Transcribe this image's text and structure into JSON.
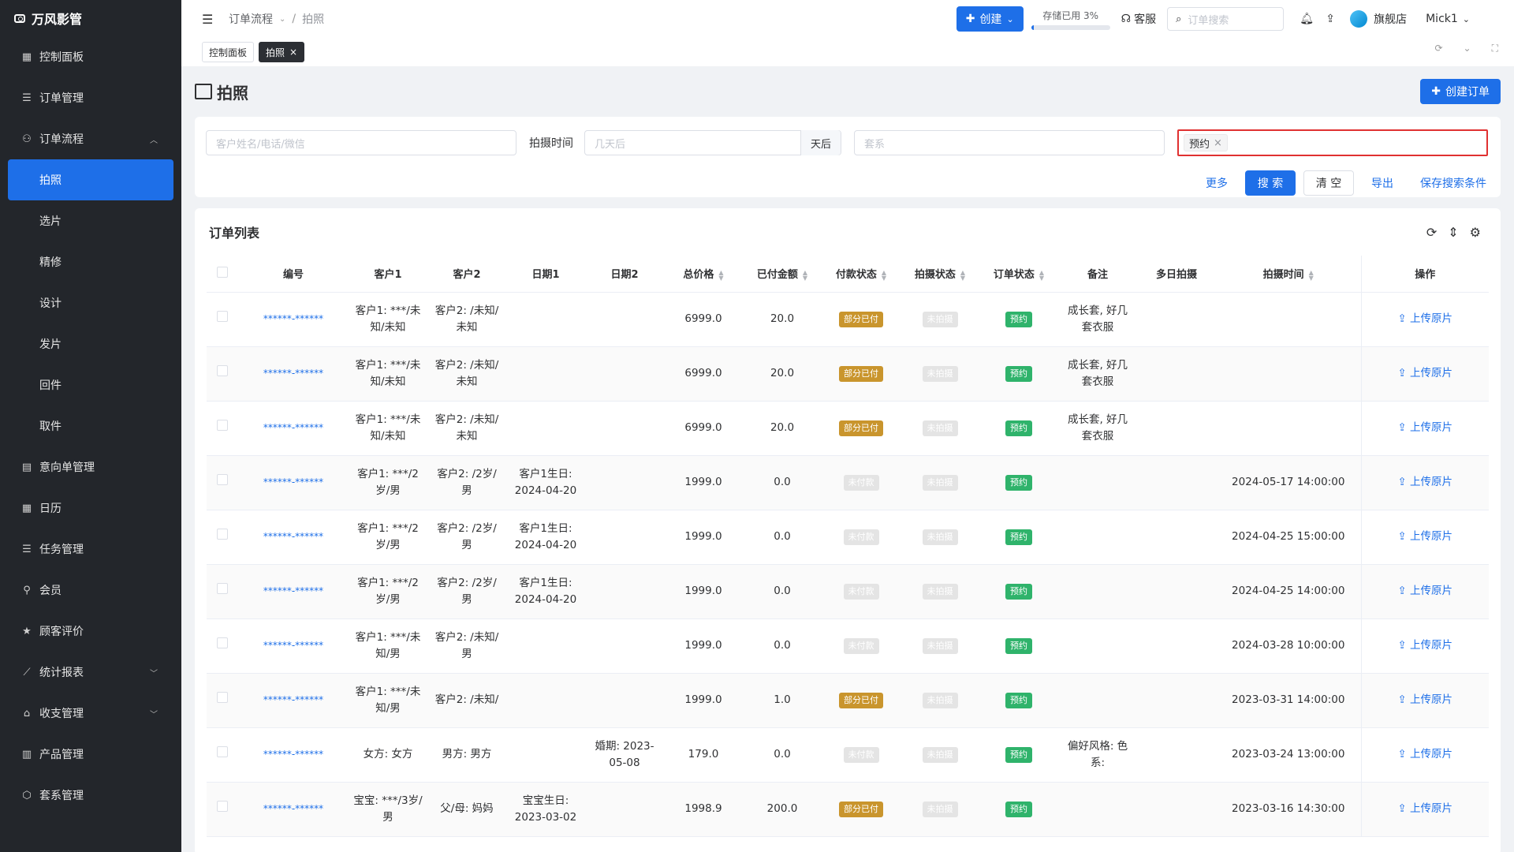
{
  "brand": "万风影管",
  "sidebar": {
    "items": [
      {
        "label": "控制面板",
        "icon": "dashboard-icon"
      },
      {
        "label": "订单管理",
        "icon": "list-icon"
      },
      {
        "label": "订单流程",
        "icon": "flow-icon",
        "expanded": true
      },
      {
        "label": "意向单管理",
        "icon": "clipboard-icon"
      },
      {
        "label": "日历",
        "icon": "calendar-icon"
      },
      {
        "label": "任务管理",
        "icon": "task-icon"
      },
      {
        "label": "会员",
        "icon": "user-icon"
      },
      {
        "label": "顾客评价",
        "icon": "star-icon"
      },
      {
        "label": "统计报表",
        "icon": "chart-icon"
      },
      {
        "label": "收支管理",
        "icon": "bank-icon"
      },
      {
        "label": "产品管理",
        "icon": "product-icon"
      },
      {
        "label": "套系管理",
        "icon": "package-icon"
      }
    ],
    "sub_items": [
      "拍照",
      "选片",
      "精修",
      "设计",
      "发片",
      "回件",
      "取件"
    ],
    "active_sub": "拍照"
  },
  "header": {
    "breadcrumb": [
      "订单流程",
      "拍照"
    ],
    "create_label": "创建",
    "storage_label": "存储已用 3%",
    "storage_used": 0.03,
    "service_label": "客服",
    "search_placeholder": "订单搜索",
    "shop_label": "旗舰店",
    "user_label": "Mick1"
  },
  "tabs": [
    {
      "label": "控制面板",
      "active": false
    },
    {
      "label": "拍照",
      "active": true
    }
  ],
  "page": {
    "title": "拍照",
    "create_order_label": "创建订单"
  },
  "filters": {
    "customer_placeholder": "客户姓名/电话/微信",
    "time_label": "拍摄时间",
    "days_placeholder": "几天后",
    "days_suffix": "天后",
    "package_placeholder": "套系",
    "chip_label": "预约",
    "more_label": "更多",
    "search_label": "搜 索",
    "clear_label": "清 空",
    "export_label": "导出",
    "save_label": "保存搜索条件"
  },
  "table": {
    "title": "订单列表",
    "columns": [
      "编号",
      "客户1",
      "客户2",
      "日期1",
      "日期2",
      "总价格",
      "已付金额",
      "付款状态",
      "拍摄状态",
      "订单状态",
      "备注",
      "多日拍摄",
      "拍摄时间",
      "操作"
    ],
    "action_label": "上传原片",
    "rows": [
      {
        "id": "******-******",
        "c1": "客户1: ***/未知/未知",
        "c2": "客户2: /未知/未知",
        "d1": "",
        "d2": "",
        "total": "6999.0",
        "paid": "20.0",
        "pay": "部分已付",
        "shoot": "未拍摄",
        "order": "预约",
        "note": "成长套, 好几套衣服",
        "multi": "",
        "time": ""
      },
      {
        "id": "******-******",
        "c1": "客户1: ***/未知/未知",
        "c2": "客户2: /未知/未知",
        "d1": "",
        "d2": "",
        "total": "6999.0",
        "paid": "20.0",
        "pay": "部分已付",
        "shoot": "未拍摄",
        "order": "预约",
        "note": "成长套, 好几套衣服",
        "multi": "",
        "time": ""
      },
      {
        "id": "******-******",
        "c1": "客户1: ***/未知/未知",
        "c2": "客户2: /未知/未知",
        "d1": "",
        "d2": "",
        "total": "6999.0",
        "paid": "20.0",
        "pay": "部分已付",
        "shoot": "未拍摄",
        "order": "预约",
        "note": "成长套, 好几套衣服",
        "multi": "",
        "time": ""
      },
      {
        "id": "******-******",
        "c1": "客户1: ***/2岁/男",
        "c2": "客户2: /2岁/男",
        "d1": "客户1生日: 2024-04-20",
        "d2": "",
        "total": "1999.0",
        "paid": "0.0",
        "pay": "未付款",
        "shoot": "未拍摄",
        "order": "预约",
        "note": "",
        "multi": "",
        "time": "2024-05-17 14:00:00"
      },
      {
        "id": "******-******",
        "c1": "客户1: ***/2岁/男",
        "c2": "客户2: /2岁/男",
        "d1": "客户1生日: 2024-04-20",
        "d2": "",
        "total": "1999.0",
        "paid": "0.0",
        "pay": "未付款",
        "shoot": "未拍摄",
        "order": "预约",
        "note": "",
        "multi": "",
        "time": "2024-04-25 15:00:00"
      },
      {
        "id": "******-******",
        "c1": "客户1: ***/2岁/男",
        "c2": "客户2: /2岁/男",
        "d1": "客户1生日: 2024-04-20",
        "d2": "",
        "total": "1999.0",
        "paid": "0.0",
        "pay": "未付款",
        "shoot": "未拍摄",
        "order": "预约",
        "note": "",
        "multi": "",
        "time": "2024-04-25 14:00:00"
      },
      {
        "id": "******-******",
        "c1": "客户1: ***/未知/男",
        "c2": "客户2: /未知/男",
        "d1": "",
        "d2": "",
        "total": "1999.0",
        "paid": "0.0",
        "pay": "未付款",
        "shoot": "未拍摄",
        "order": "预约",
        "note": "",
        "multi": "",
        "time": "2024-03-28 10:00:00"
      },
      {
        "id": "******-******",
        "c1": "客户1: ***/未知/男",
        "c2": "客户2: /未知/",
        "d1": "",
        "d2": "",
        "total": "1999.0",
        "paid": "1.0",
        "pay": "部分已付",
        "shoot": "未拍摄",
        "order": "预约",
        "note": "",
        "multi": "",
        "time": "2023-03-31 14:00:00"
      },
      {
        "id": "******-******",
        "c1": "女方: 女方",
        "c2": "男方: 男方",
        "d1": "",
        "d2": "婚期: 2023-05-08",
        "total": "179.0",
        "paid": "0.0",
        "pay": "未付款",
        "shoot": "未拍摄",
        "order": "预约",
        "note": "偏好风格: 色系:",
        "multi": "",
        "time": "2023-03-24 13:00:00"
      },
      {
        "id": "******-******",
        "c1": "宝宝: ***/3岁/男",
        "c2": "父/母: 妈妈",
        "d1": "宝宝生日: 2023-03-02",
        "d2": "",
        "total": "1998.9",
        "paid": "200.0",
        "pay": "部分已付",
        "shoot": "未拍摄",
        "order": "预约",
        "note": "",
        "multi": "",
        "time": "2023-03-16 14:30:00"
      }
    ]
  },
  "colors": {
    "primary": "#1e6fe8",
    "sidebar": "#23262b",
    "gold": "#c9952d",
    "green": "#2fb36b"
  }
}
